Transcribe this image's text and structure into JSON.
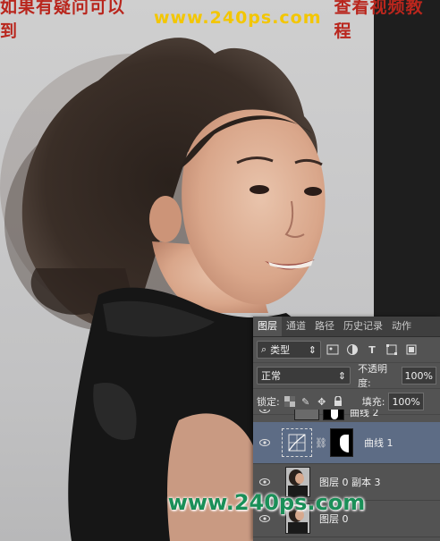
{
  "banner": {
    "left_text": "如果有疑问可以到",
    "url": "www.240ps.com",
    "right_text": "查看视频教程"
  },
  "watermark": "www.240ps.com",
  "colors": {
    "banner_red": "#b9261d",
    "banner_yellow": "#f3c600",
    "watermark_green": "#1a8f58",
    "panel_bg": "#535353",
    "selected_layer": "#5d6c85"
  },
  "layers_panel": {
    "tabs": [
      "图层",
      "通道",
      "路径",
      "历史记录",
      "动作"
    ],
    "active_tab": "图层",
    "filter": {
      "label": "类型"
    },
    "blend_mode": "正常",
    "opacity_label": "不透明度:",
    "opacity_value": "100%",
    "lock_label": "锁定:",
    "fill_label": "填充:",
    "fill_value": "100%",
    "layers": [
      {
        "name": "曲线 2",
        "type": "adjustment",
        "visible": true,
        "partially_hidden": true
      },
      {
        "name": "曲线 1",
        "type": "adjustment",
        "visible": true,
        "selected": true
      },
      {
        "name": "图层 0 副本 3",
        "type": "pixel",
        "visible": true
      },
      {
        "name": "图层 0",
        "type": "pixel",
        "visible": true
      }
    ]
  }
}
